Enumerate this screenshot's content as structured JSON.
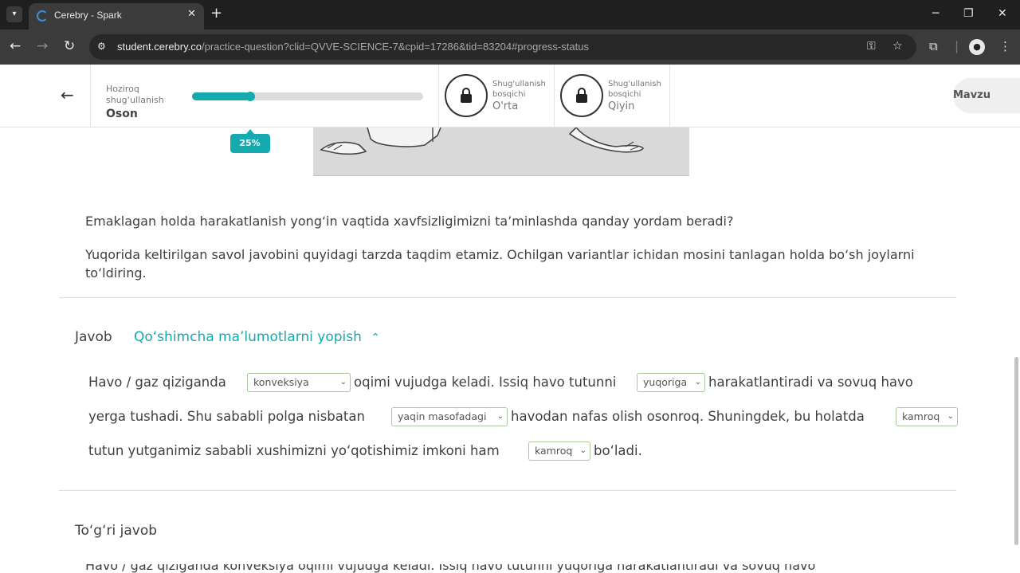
{
  "browser": {
    "tab_title": "Cerebry - Spark",
    "url_host": "student.cerebry.co",
    "url_path": "/practice-question?clid=QVVE-SCIENCE-7&cpid=17286&tid=83204#progress-status"
  },
  "header": {
    "current_label": "Hoziroq shug‘ullanish",
    "current_level": "Oson",
    "progress_percent": 25,
    "progress_label": "25%",
    "levels": [
      {
        "caption": "Shug'ullanish bosqichi",
        "name": "O'rta"
      },
      {
        "caption": "Shug'ullanish bosqichi",
        "name": "Qiyin"
      }
    ],
    "topic_button": "Mavzu"
  },
  "question": {
    "text": "Emaklagan holda harakatlanish yong‘in vaqtida xavfsizligimizni ta’minlashda qanday yordam beradi?",
    "instruction": "Yuqorida keltirilgan savol javobini quyidagi tarzda taqdim etamiz. Ochilgan variantlar ichidan mosini tanlagan holda bo‘sh joylarni to‘ldiring."
  },
  "answer": {
    "label": "Javob",
    "toggle": "Qo‘shimcha ma’lumotlarni yopish",
    "line1": {
      "t1": "Havo / gaz qiziganda",
      "t2": "oqimi vujudga keladi. Issiq havo tutunni",
      "t3": "harakatlantiradi va sovuq havo"
    },
    "line2": {
      "t1": "yerga tushadi. Shu sababli polga nisbatan",
      "t2": "havodan nafas olish osonroq. Shuningdek, bu holatda"
    },
    "line3": {
      "t1": "tutun yutganimiz sababli xushimizni yo‘qotishimiz imkoni ham",
      "t2": "bo‘ladi."
    },
    "blanks": [
      "konveksiya",
      "yuqoriga",
      "yaqin masofadagi",
      "kamroq",
      "kamroq"
    ]
  },
  "correct": {
    "label": "To‘g‘ri javob",
    "text_cut": "Havo / gaz qiziganda konveksiya oqimi vujudga keladi. Issiq havo tutunni yuqoriga harakatlantiradi va sovuq havo"
  },
  "icons": {
    "back": "arrow-left-icon",
    "lock": "lock-icon",
    "caret": "chevron-down-icon"
  },
  "colors": {
    "accent": "#14aab0",
    "blank_border": "#a8c89a",
    "chrome_dark": "#1f1f1f",
    "chrome_bar": "#3b3b3b"
  }
}
